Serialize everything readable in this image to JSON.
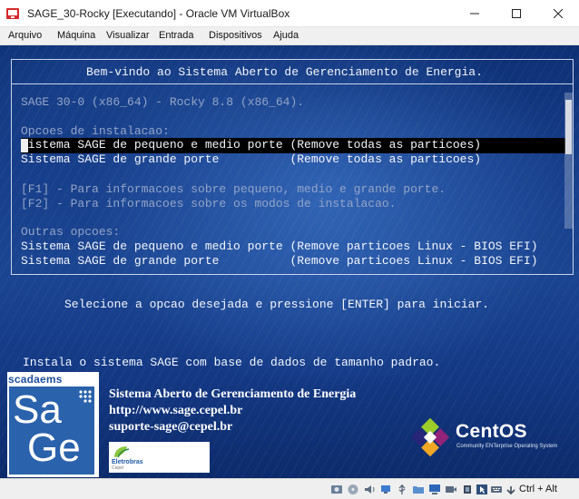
{
  "window": {
    "title": "SAGE_30-Rocky [Executando] - Oracle VM VirtualBox"
  },
  "menu": [
    "Arquivo",
    "Máquina",
    "Visualizar",
    "Entrada",
    "Dispositivos",
    "Ajuda"
  ],
  "boot": {
    "header": "Bem-vindo ao Sistema Aberto de Gerenciamento de Energia.",
    "version": "SAGE 30-0 (x86_64) - Rocky 8.8 (x86_64).",
    "install_heading": "Opcoes de instalacao:",
    "install_options": [
      "Sistema SAGE de pequeno e medio porte (Remove todas as particoes)",
      "Sistema SAGE de grande porte          (Remove todas as particoes)"
    ],
    "help_lines": [
      "[F1] - Para informacoes sobre pequeno, medio e grande porte.",
      "[F2] - Para informacoes sobre os modos de instalacao."
    ],
    "other_heading": "Outras opcoes:",
    "other_options": [
      "Sistema SAGE de pequeno e medio porte (Remove particoes Linux - BIOS EFI)",
      "Sistema SAGE de grande porte          (Remove particoes Linux - BIOS EFI)"
    ],
    "prompt": "Selecione a opcao desejada e pressione [ENTER] para iniciar.",
    "description": "Instala o sistema SAGE com base de dados de tamanho padrao."
  },
  "branding": {
    "scadaems": "scadaems",
    "sage_top": "Sa",
    "sage_bottom": "Ge",
    "info": [
      "Sistema Aberto de Gerenciamento de Energia",
      "http://www.sage.cepel.br",
      "suporte-sage@cepel.br"
    ],
    "eletrobras": "Eletrobras",
    "eletrobras_sub": "Cepel",
    "centos": "CentOS",
    "centos_tagline": "Community ENTerprise Operating System"
  },
  "statusbar": {
    "host_key": "Ctrl + Alt",
    "icons": [
      "hard-disk-icon",
      "optical-drive-icon",
      "audio-icon",
      "network-icon",
      "usb-icon",
      "shared-folders-icon",
      "display-icon",
      "video-capture-icon",
      "cpu-icon",
      "mouse-integration-icon",
      "keyboard-capture-icon",
      "host-key-arrow-icon"
    ]
  },
  "colors": {
    "highlight_bg": "#000000",
    "screen_blue": "#173e8a",
    "menu_text_white": "#f4f6fb",
    "dim_text": "#93a4c7"
  }
}
